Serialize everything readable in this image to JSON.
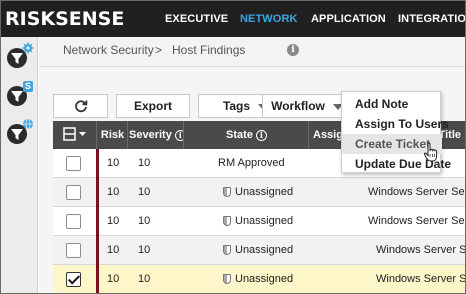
{
  "app": {
    "logo_text": "RISKSENSE"
  },
  "topnav": {
    "items": [
      {
        "label": "EXECUTIVE",
        "active": false
      },
      {
        "label": "NETWORK",
        "active": true
      },
      {
        "label": "APPLICATION",
        "active": false
      },
      {
        "label": "INTEGRATIONS",
        "active": false
      }
    ],
    "active_color": "#3fa4e0"
  },
  "sidebar": {
    "icons": [
      "gear-funnel-icon",
      "dollar-funnel-icon",
      "globe-funnel-icon"
    ],
    "badge_letter": "S"
  },
  "breadcrumb": {
    "parent": "Network Security",
    "separator": ">",
    "current": "Host Findings"
  },
  "toolbar": {
    "export_label": "Export",
    "tags_label": "Tags",
    "workflow_label": "Workflow"
  },
  "table": {
    "columns": [
      "Risk",
      "Severity",
      "State",
      "Assign",
      "Title"
    ],
    "rows": [
      {
        "checked": false,
        "risk": "10",
        "severity": "10",
        "state": "RM Approved",
        "state_icon": false,
        "title": ""
      },
      {
        "checked": false,
        "risk": "10",
        "severity": "10",
        "state": "Unassigned",
        "state_icon": true,
        "title": "Windows Server Serv"
      },
      {
        "checked": false,
        "risk": "10",
        "severity": "10",
        "state": "Unassigned",
        "state_icon": true,
        "title": "Windows Server Serv"
      },
      {
        "checked": false,
        "risk": "10",
        "severity": "10",
        "state": "Unassigned",
        "state_icon": true,
        "title": "Windows Server S"
      },
      {
        "checked": true,
        "risk": "10",
        "severity": "10",
        "state": "Unassigned",
        "state_icon": true,
        "title": "Windows Server S"
      }
    ]
  },
  "workflow_menu": {
    "items": [
      "Add Note",
      "Assign To Users",
      "Create Ticket",
      "Update Due Date"
    ],
    "hovered_index": 2
  },
  "colors": {
    "topbar": "#202020",
    "header": "#4a4a4a",
    "risk_bar": "#7a1020",
    "selected_row": "#fcf6c8"
  }
}
